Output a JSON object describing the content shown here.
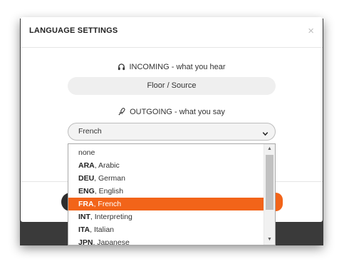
{
  "modal": {
    "title": "LANGUAGE SETTINGS",
    "close_glyph": "×",
    "incoming": {
      "label": "INCOMING - what you hear",
      "icon": "headphones-icon",
      "value": "Floor / Source"
    },
    "outgoing": {
      "label": "OUTGOING - what you say",
      "icon": "microphone-icon",
      "selected_value": "French"
    }
  },
  "dropdown": {
    "options": [
      {
        "code": "",
        "name": "none"
      },
      {
        "code": "ARA",
        "name": ", Arabic"
      },
      {
        "code": "DEU",
        "name": ", German"
      },
      {
        "code": "ENG",
        "name": ", English"
      },
      {
        "code": "FRA",
        "name": ", French"
      },
      {
        "code": "INT",
        "name": ", Interpreting"
      },
      {
        "code": "ITA",
        "name": ", Italian"
      },
      {
        "code": "JPN",
        "name": ", Japanese"
      }
    ],
    "selected_index": 4,
    "scroll_up_glyph": "▲",
    "scroll_down_glyph": "▼"
  },
  "colors": {
    "accent": "#f26419",
    "dark_button": "#2e2e2e"
  }
}
